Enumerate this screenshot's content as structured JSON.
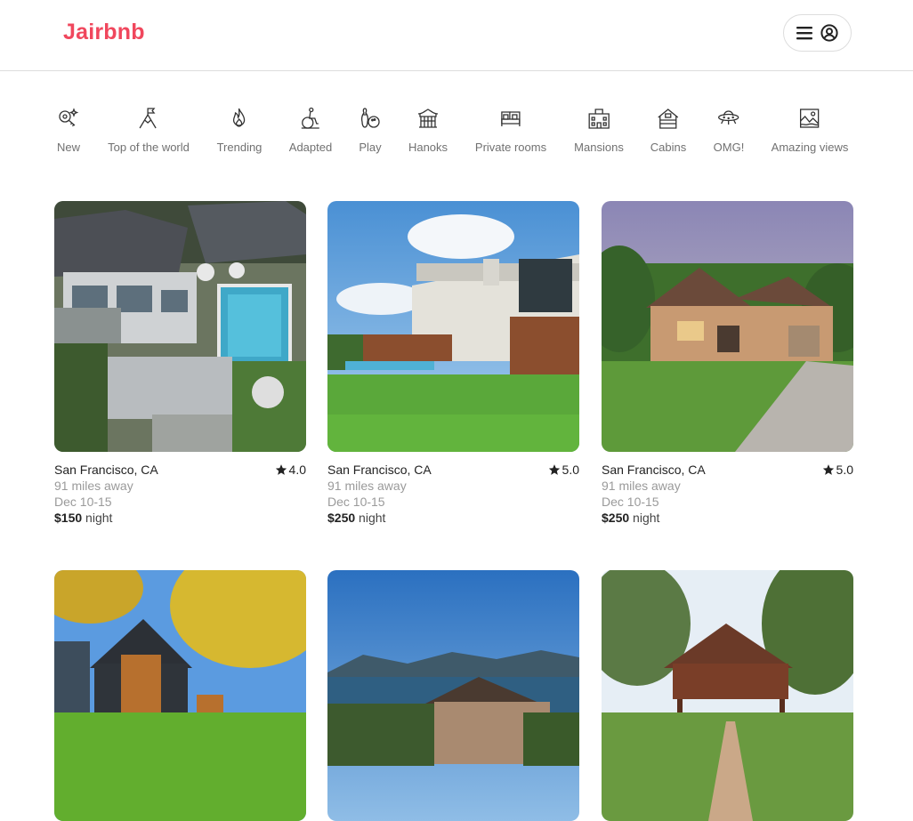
{
  "brand": {
    "name": "Jairbnb",
    "color": "#f0475d"
  },
  "header": {
    "menu_icon": "hamburger-icon",
    "profile_icon": "user-circle-icon"
  },
  "categories": [
    {
      "label": "New",
      "icon": "sparkle-key-icon"
    },
    {
      "label": "Top of the world",
      "icon": "mountain-flag-icon"
    },
    {
      "label": "Trending",
      "icon": "flame-icon"
    },
    {
      "label": "Adapted",
      "icon": "wheelchair-icon"
    },
    {
      "label": "Play",
      "icon": "bowling-icon"
    },
    {
      "label": "Hanoks",
      "icon": "hanok-icon"
    },
    {
      "label": "Private rooms",
      "icon": "bed-icon"
    },
    {
      "label": "Mansions",
      "icon": "mansion-icon"
    },
    {
      "label": "Cabins",
      "icon": "cabin-icon"
    },
    {
      "label": "OMG!",
      "icon": "ufo-icon"
    },
    {
      "label": "Amazing views",
      "icon": "landscape-icon"
    }
  ],
  "listings": [
    {
      "location": "San Francisco, CA",
      "rating": "4.0",
      "distance": "91 miles away",
      "dates": "Dec 10-15",
      "price": "$150",
      "unit": "night"
    },
    {
      "location": "San Francisco, CA",
      "rating": "5.0",
      "distance": "91 miles away",
      "dates": "Dec 10-15",
      "price": "$250",
      "unit": "night"
    },
    {
      "location": "San Francisco, CA",
      "rating": "5.0",
      "distance": "91 miles away",
      "dates": "Dec 10-15",
      "price": "$250",
      "unit": "night"
    },
    {
      "location": "",
      "rating": "",
      "distance": "",
      "dates": "",
      "price": "",
      "unit": ""
    },
    {
      "location": "",
      "rating": "",
      "distance": "",
      "dates": "",
      "price": "",
      "unit": ""
    },
    {
      "location": "",
      "rating": "",
      "distance": "",
      "dates": "",
      "price": "",
      "unit": ""
    }
  ]
}
